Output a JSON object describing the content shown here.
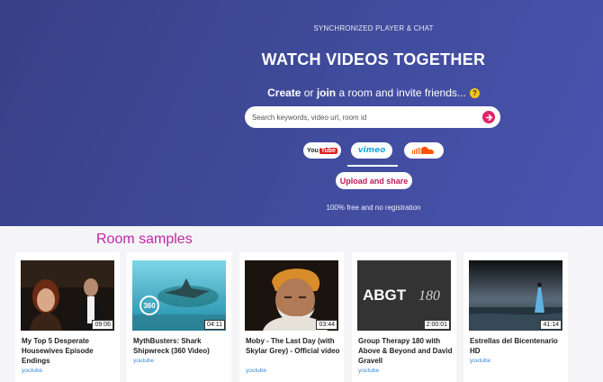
{
  "hero": {
    "subtitle": "SYNCHRONIZED PLAYER & CHAT",
    "headline": "WATCH VIDEOS TOGETHER",
    "tagline_create": "Create",
    "tagline_or": " or ",
    "tagline_join": "join",
    "tagline_rest": " a room and invite friends...",
    "help_glyph": "?",
    "search_placeholder": "Search keywords, video url, room id",
    "providers": [
      "YouTube",
      "vimeo",
      "SoundCloud"
    ],
    "selected_provider": "vimeo",
    "upload_label": "Upload and share",
    "free_note": "100% free and no registration"
  },
  "colors": {
    "accent": "#c026a8",
    "go_button": "#e0246b",
    "link": "#3b8ad8"
  },
  "samples": {
    "title": "Room samples",
    "items": [
      {
        "title": "My Top 5 Desperate Housewives Episode Endings",
        "source": "youtube",
        "duration": "09:06"
      },
      {
        "title": "MythBusters: Shark Shipwreck (360 Video)",
        "source": "youtube",
        "duration": "04:11"
      },
      {
        "title": "Moby - The Last Day (with Skylar Grey) - Official video",
        "source": "youtube",
        "duration": "03:44"
      },
      {
        "title": "Group Therapy 180 with Above & Beyond and David Gravell",
        "source": "youtube",
        "duration": "2:00:01"
      },
      {
        "title": "Estrellas del Bicentenario HD",
        "source": "youtube",
        "duration": "41:14"
      }
    ],
    "thumb_texts": {
      "badge_360": "360",
      "abgt": "ABGT",
      "abgt_num": "180"
    }
  }
}
